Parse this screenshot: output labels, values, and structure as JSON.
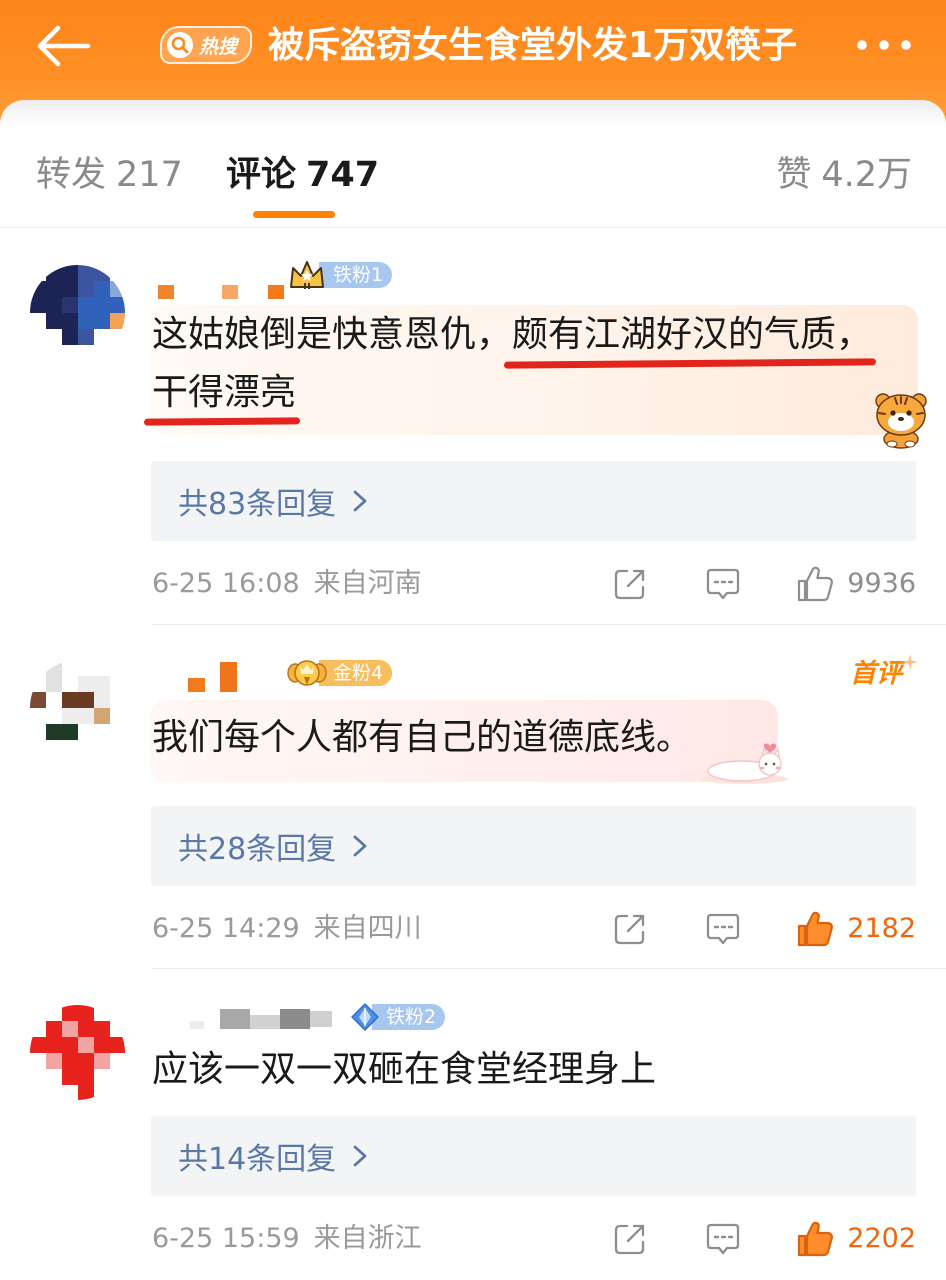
{
  "header": {
    "back_icon": "back-arrow-icon",
    "hot_icon": "search-icon",
    "hot_label": "热搜",
    "title": "被斥盗窃女生食堂外发1万双筷子",
    "more_icon": "more-icon"
  },
  "tabs": [
    {
      "label": "转发",
      "count": "217",
      "active": false
    },
    {
      "label": "评论",
      "count": "747",
      "active": true
    },
    {
      "label": "赞",
      "count": "4.2万",
      "active": false
    }
  ],
  "comments": [
    {
      "badge": {
        "label": "铁粉1",
        "icon": "crown-icon",
        "tier": "iron"
      },
      "tag": "",
      "segments": [
        {
          "text": "这姑娘倒是快意恩仇，",
          "marked": false
        },
        {
          "text": "颇有江湖好汉的气质，",
          "marked": true
        },
        {
          "text": "干得漂亮",
          "marked": true
        }
      ],
      "sticker": "tiger-sticker",
      "replies": "共83条回复",
      "time": "6-25 16:08",
      "location": "来自河南",
      "likes": "9936",
      "liked": false
    },
    {
      "badge": {
        "label": "金粉4",
        "icon": "gold-fan-icon",
        "tier": "gold"
      },
      "tag": "首评",
      "segments": [
        {
          "text": "我们每个人都有自己的道德底线。",
          "marked": false
        }
      ],
      "sticker": "cat-sticker",
      "replies": "共28条回复",
      "time": "6-25 14:29",
      "location": "来自四川",
      "likes": "2182",
      "liked": true
    },
    {
      "badge": {
        "label": "铁粉2",
        "icon": "diamond-icon",
        "tier": "iron"
      },
      "tag": "",
      "segments": [
        {
          "text": "应该一双一双砸在食堂经理身上",
          "marked": false
        }
      ],
      "sticker": "",
      "replies": "共14条回复",
      "time": "6-25 15:59",
      "location": "来自浙江",
      "likes": "2202",
      "liked": true
    }
  ],
  "actions": {
    "share_icon": "share-icon",
    "comment_icon": "comment-icon",
    "like_icon": "like-icon",
    "replies_icon": "chevron-right-icon"
  },
  "colors": {
    "header": "#ff8a1a",
    "accent": "#ff8200",
    "reply_link": "#5a78a6",
    "annotation": "#e3241d",
    "iron_badge": "#a7c7ee",
    "gold_badge": "#f8bd5e",
    "muted": "#9a9a9a"
  }
}
